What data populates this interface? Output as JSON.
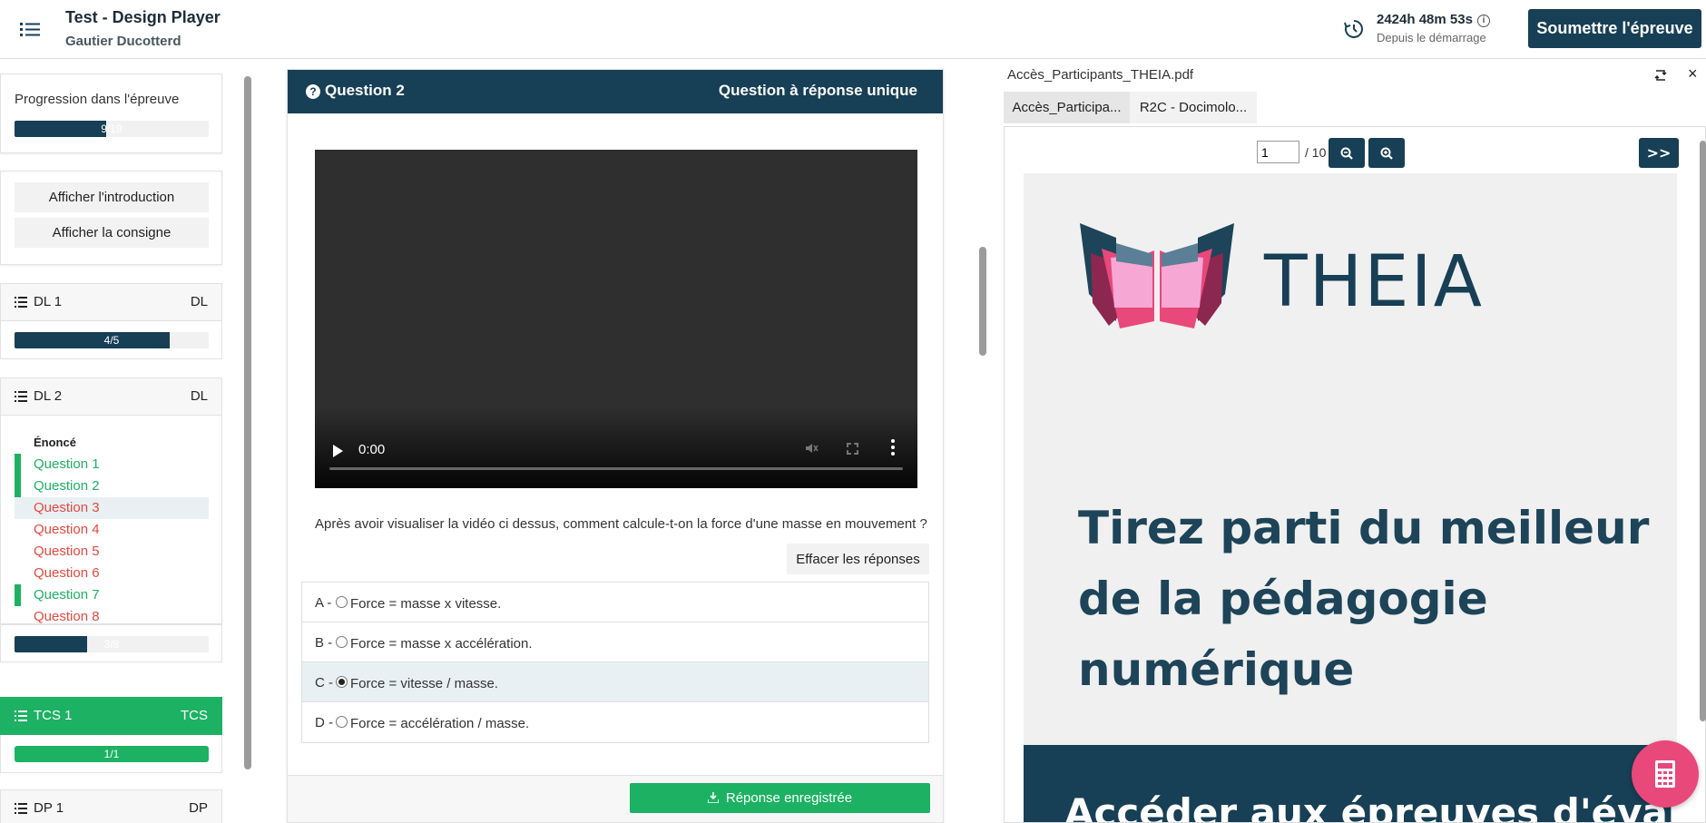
{
  "header": {
    "title": "Test - Design Player",
    "user": "Gautier Ducotterd",
    "timer": "2424h 48m 53s",
    "timer_label": "Depuis le démarrage",
    "info_glyph": "i",
    "submit_label": "Soumettre l'épreuve",
    "icons": {
      "menu": "list-icon",
      "timer": "timer-refresh-icon",
      "info": "info-icon"
    }
  },
  "sidebar": {
    "progress": {
      "label": "Progression dans l'épreuve",
      "text": "9/19",
      "value": 9,
      "max": 19
    },
    "buttons": {
      "intro": "Afficher l'introduction",
      "instructions": "Afficher la consigne"
    },
    "sections": [
      {
        "title": "DL 1",
        "code": "DL",
        "progress_text": "4/5",
        "value": 4,
        "max": 5
      },
      {
        "title": "DL 2",
        "code": "DL",
        "progress_text": "3/8",
        "value": 3,
        "max": 8,
        "heading": "Énoncé",
        "questions": [
          {
            "label": "Question 1",
            "status": "answered"
          },
          {
            "label": "Question 2",
            "status": "answered"
          },
          {
            "label": "Question 3",
            "status": "unanswered",
            "current": true
          },
          {
            "label": "Question 4",
            "status": "unanswered"
          },
          {
            "label": "Question 5",
            "status": "unanswered"
          },
          {
            "label": "Question 6",
            "status": "unanswered"
          },
          {
            "label": "Question 7",
            "status": "answered"
          },
          {
            "label": "Question 8",
            "status": "unanswered"
          }
        ]
      },
      {
        "title": "TCS 1",
        "code": "TCS",
        "progress_text": "1/1",
        "value": 1,
        "max": 1
      },
      {
        "title": "DP 1",
        "code": "DP"
      }
    ]
  },
  "question": {
    "icon_glyph": "?",
    "title": "Question 2",
    "type": "Question à réponse unique",
    "video_time": "0:00",
    "text": "Après avoir visualiser la vidéo ci dessus, comment calcule-t-on la force d'une masse en mouvement ?",
    "clear_label": "Effacer les réponses",
    "options": [
      {
        "letter": "A -",
        "text": "Force = masse x vitesse.",
        "selected": false
      },
      {
        "letter": "B -",
        "text": "Force = masse x accélération.",
        "selected": false
      },
      {
        "letter": "C -",
        "text": "Force = vitesse / masse.",
        "selected": true
      },
      {
        "letter": "D -",
        "text": "Force = accélération / masse.",
        "selected": false
      }
    ],
    "saved_label": "Réponse enregistrée"
  },
  "viewer": {
    "file_title": "Accès_Participants_THEIA.pdf",
    "close_glyph": "×",
    "tabs": [
      {
        "label": "Accès_Participa...",
        "active": true
      },
      {
        "label": "R2C - Docimolo...",
        "active": false
      }
    ],
    "page_current": "1",
    "page_total": "/ 10",
    "next_glyph": ">>",
    "pdf": {
      "brand": "THEIA",
      "headline": "Tirez parti du meilleur de la pédagogie numérique",
      "band_text": "Accéder aux épreuves d'évaluati"
    }
  },
  "colors": {
    "primary": "#173f55",
    "success": "#1db163",
    "danger": "#e5483f",
    "accent": "#e8487a"
  }
}
